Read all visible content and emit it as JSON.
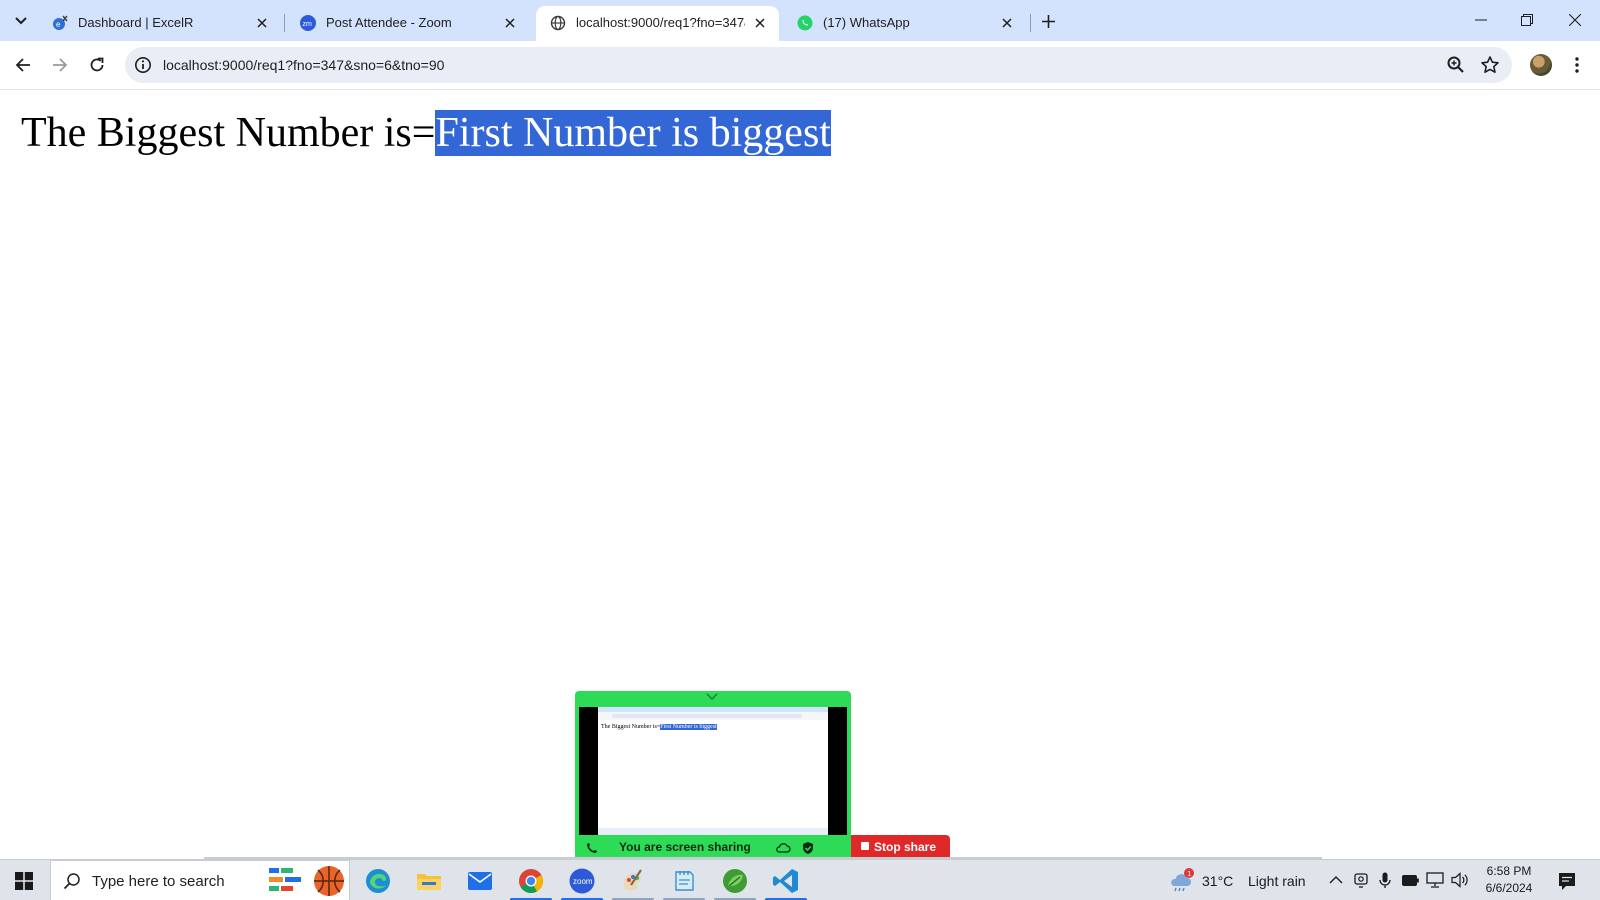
{
  "browser": {
    "tabs": [
      {
        "title": "Dashboard | ExcelR",
        "icon": "excelr-favicon"
      },
      {
        "title": "Post Attendee - Zoom",
        "icon": "zoom-favicon"
      },
      {
        "title": "localhost:9000/req1?fno=347&sno=6&tno=90",
        "icon": "globe-favicon",
        "active": true
      },
      {
        "title": "(17) WhatsApp",
        "icon": "whatsapp-favicon"
      }
    ],
    "address": "localhost:9000/req1?fno=347&sno=6&tno=90"
  },
  "page": {
    "prefix": "The Biggest Number is=",
    "selected": "First Number is biggest"
  },
  "zoom_share": {
    "status": "You are screen sharing",
    "stop_label": "Stop share",
    "bar_color": "#2edb57",
    "stop_color": "#e02828"
  },
  "taskbar": {
    "search_placeholder": "Type here to search",
    "apps": [
      "edge",
      "file-explorer",
      "mail",
      "chrome",
      "zoom",
      "paint",
      "notepad",
      "app-green",
      "vscode"
    ],
    "weather": {
      "temp": "31°C",
      "condition": "Light rain",
      "alert_count": "1"
    },
    "clock": {
      "time": "6:58 PM",
      "date": "6/6/2024"
    }
  },
  "colors": {
    "tabstrip": "#d3e3fd",
    "selection": "#3367d6",
    "accent": "#1f6feb"
  }
}
